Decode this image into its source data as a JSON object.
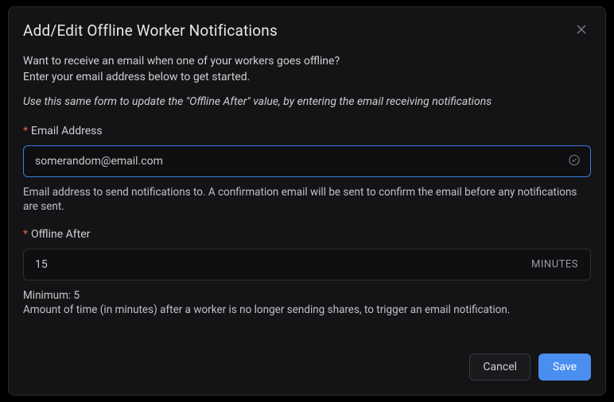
{
  "modal": {
    "title": "Add/Edit Offline Worker Notifications",
    "intro_line1": "Want to receive an email when one of your workers goes offline?",
    "intro_line2": "Enter your email address below to get started.",
    "italic_note": "Use this same form to update the \"Offline After\" value, by entering the email receiving notifications",
    "email_field": {
      "label": "Email Address",
      "value": "somerandom@email.com",
      "help": "Email address to send notifications to. A confirmation email will be sent to confirm the email before any notifications are sent."
    },
    "offline_field": {
      "label": "Offline After",
      "value": "15",
      "suffix": "MINUTES",
      "minimum_label": "Minimum: 5",
      "help": "Amount of time (in minutes) after a worker is no longer sending shares, to trigger an email notification."
    },
    "footer": {
      "cancel": "Cancel",
      "save": "Save"
    }
  }
}
